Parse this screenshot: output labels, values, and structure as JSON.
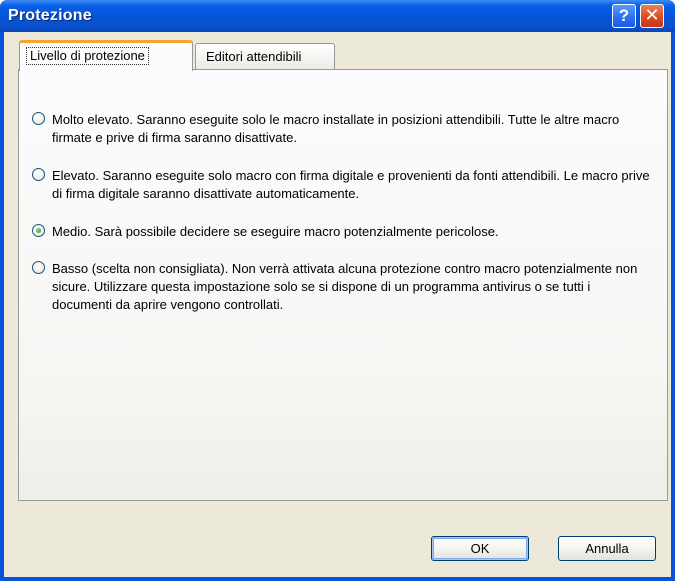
{
  "window": {
    "title": "Protezione"
  },
  "titlebar": {
    "help_icon": "?",
    "close_icon": "✕"
  },
  "tabs": [
    {
      "label": "Livello di protezione",
      "active": true
    },
    {
      "label": "Editori attendibili",
      "active": false
    }
  ],
  "options": [
    {
      "label": "Molto elevato. Saranno eseguite solo le macro installate in posizioni attendibili. Tutte le altre macro firmate e prive di firma saranno disattivate.",
      "checked": false
    },
    {
      "label": "Elevato. Saranno eseguite solo macro con firma digitale e provenienti da fonti attendibili. Le macro prive di firma digitale saranno disattivate automaticamente.",
      "checked": false
    },
    {
      "label": "Medio. Sarà possibile decidere se eseguire macro potenzialmente pericolose.",
      "checked": true
    },
    {
      "label": "Basso (scelta non consigliata). Non verrà attivata alcuna protezione contro macro potenzialmente non sicure. Utilizzare questa impostazione solo se si dispone di un programma antivirus o se tutti i documenti da aprire vengono controllati.",
      "checked": false
    }
  ],
  "buttons": {
    "ok": "OK",
    "cancel": "Annulla"
  },
  "colors": {
    "titlebar": "#0454d8",
    "dialog_bg": "#ece9d8",
    "active_tab_accent": "#f4a52d"
  }
}
